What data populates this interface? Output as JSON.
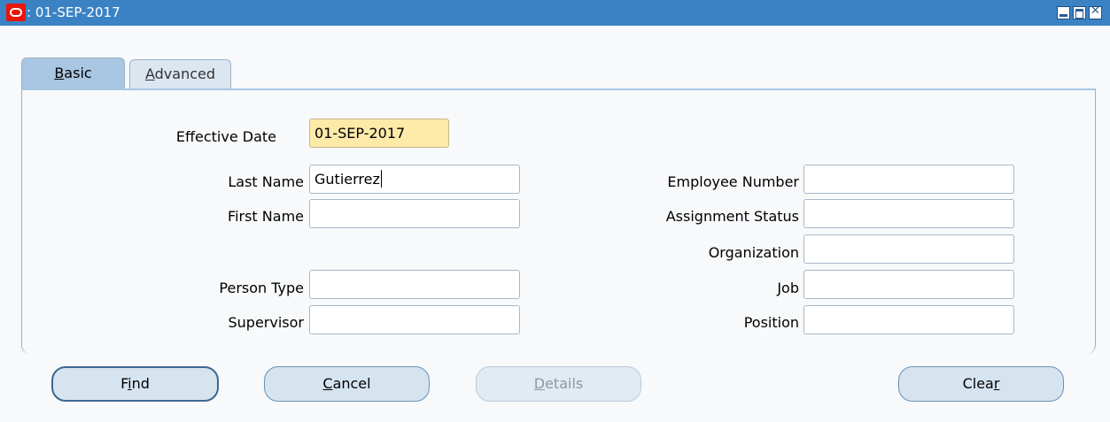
{
  "window": {
    "title": ": 01-SEP-2017",
    "logo_icon": "oracle-logo-icon",
    "controls": [
      "minimize-icon",
      "maximize-icon",
      "close-icon"
    ]
  },
  "tabs": [
    {
      "label": "Basic",
      "mnemonic_char": "B",
      "rest": "asic",
      "active": true
    },
    {
      "label": "Advanced",
      "mnemonic_char": "A",
      "rest": "dvanced",
      "active": false
    }
  ],
  "form": {
    "effective_date": {
      "label": "Effective Date",
      "value": "01-SEP-2017"
    },
    "last_name": {
      "label": "Last Name",
      "value": "Gutierrez"
    },
    "first_name": {
      "label": "First Name",
      "value": ""
    },
    "person_type": {
      "label": "Person Type",
      "value": ""
    },
    "supervisor": {
      "label": "Supervisor",
      "value": ""
    },
    "employee_number": {
      "label": "Employee Number",
      "value": ""
    },
    "assignment_status": {
      "label": "Assignment Status",
      "value": ""
    },
    "organization": {
      "label": "Organization",
      "value": ""
    },
    "job": {
      "label": "Job",
      "value": ""
    },
    "position": {
      "label": "Position",
      "value": ""
    }
  },
  "buttons": {
    "find": {
      "label": "Find",
      "pre": "F",
      "mn": "i",
      "post": "nd"
    },
    "cancel": {
      "label": "Cancel",
      "pre": "",
      "mn": "C",
      "post": "ancel"
    },
    "details": {
      "label": "Details",
      "pre": "",
      "mn": "D",
      "post": "etails"
    },
    "clear": {
      "label": "Clear",
      "pre": "Clea",
      "mn": "r",
      "post": ""
    }
  },
  "colors": {
    "titlebar": "#3a82c4",
    "active_tab": "#a9c6e2",
    "required_field": "#fde9a8",
    "button": "#d6e4f0"
  }
}
